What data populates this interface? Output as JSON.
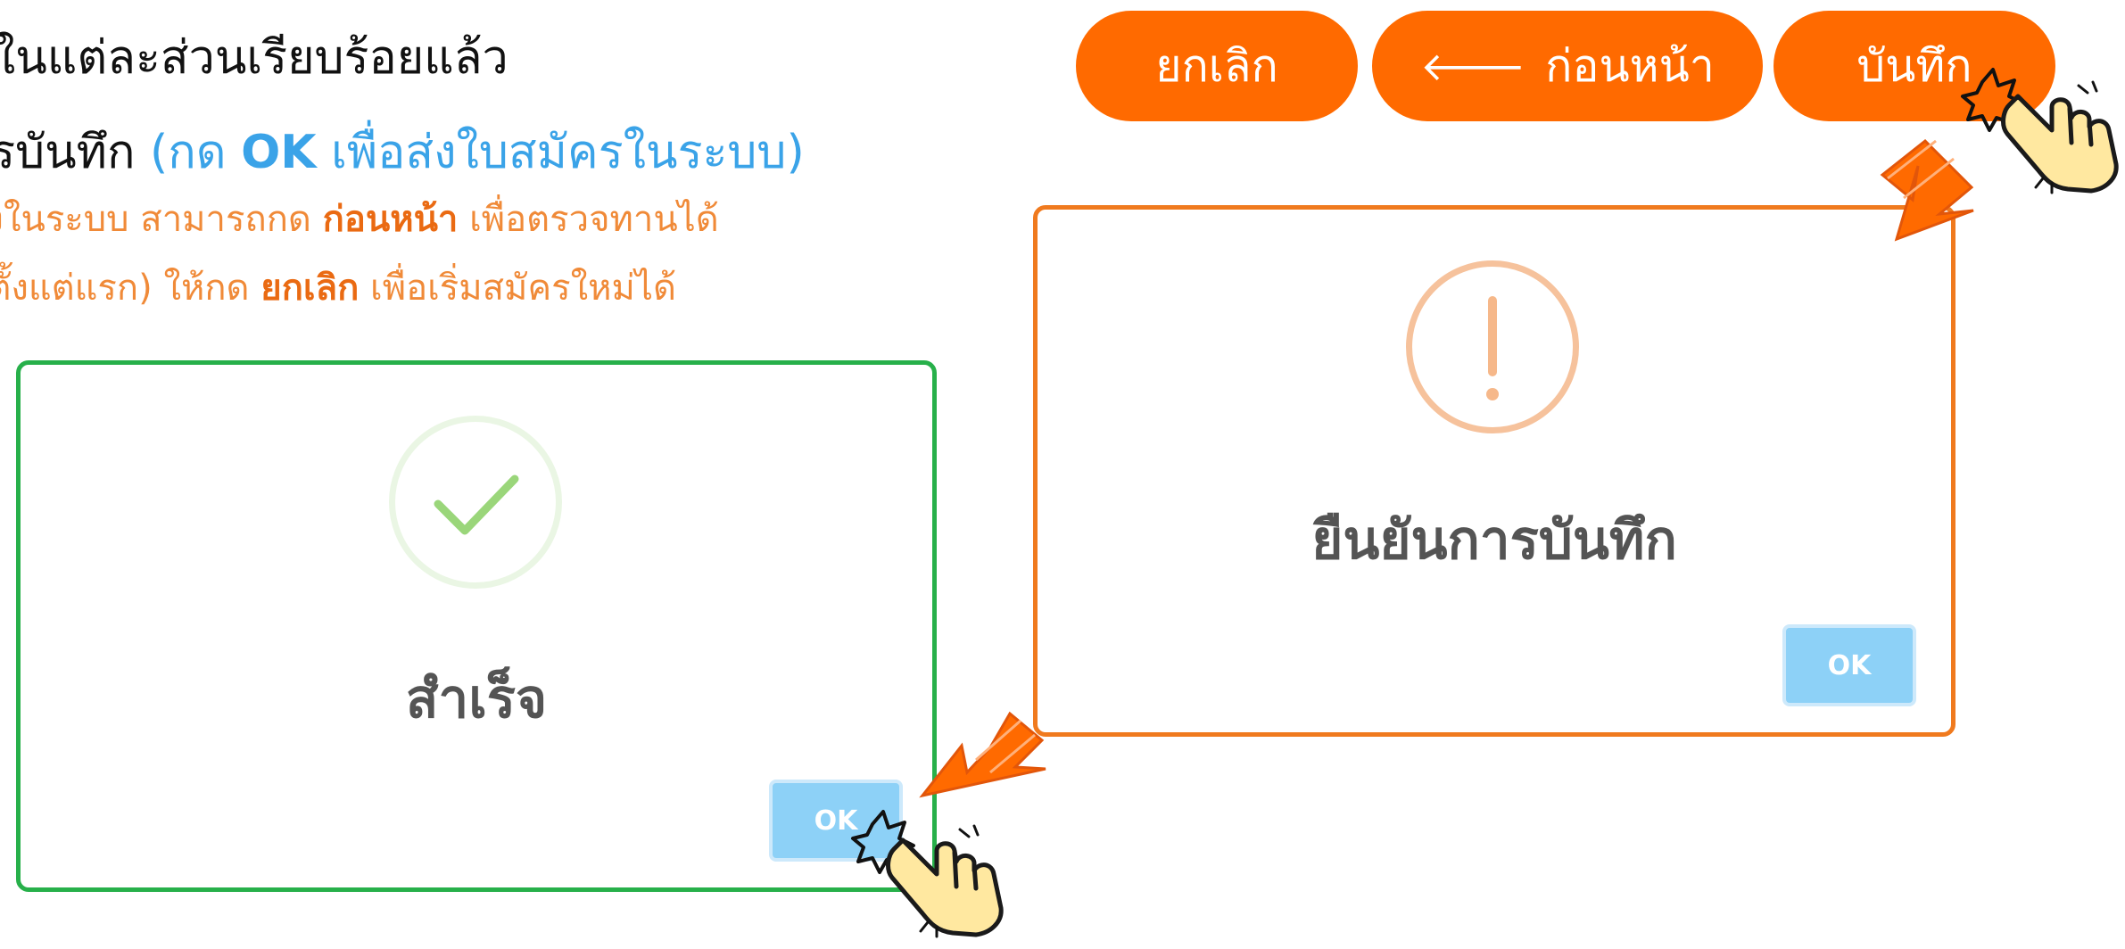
{
  "instructions": {
    "line1": "ูลในแต่ละส่วนเรียบร้อยแล้ว",
    "line2_prefix": "ารบันทึก ",
    "line2_paren_open": "(กด ",
    "line2_ok": "OK",
    "line2_paren_rest": "  เพื่อส่งใบสมัครในระบบ)",
    "line3_prefix": "ส่งในระบบ สามารถกด ",
    "line3_bold": "ก่อนหน้า",
    "line3_suffix": " เพื่อตรวจทานได้",
    "line4_prefix": "ม่ตั้งแต่แรก) ให้กด ",
    "line4_bold": "ยกเลิก",
    "line4_suffix": " เพื่อเริ่มสมัครใหม่ได้"
  },
  "toolbar": {
    "cancel_label": "ยกเลิก",
    "prev_arrow": "🡐",
    "prev_label": "ก่อนหน้า",
    "save_label": "บันทึก"
  },
  "confirm_dialog": {
    "title": "ยืนยันการบันทึก",
    "ok_label": "OK",
    "icon": "exclamation-icon"
  },
  "success_dialog": {
    "title": "สำเร็จ",
    "ok_label": "OK",
    "icon": "checkmark-icon"
  },
  "colors": {
    "primary_orange": "#ff6a00",
    "info_blue": "#3aa3e8",
    "success_green": "#27b04a",
    "ok_button_blue": "#8dd1f7"
  }
}
